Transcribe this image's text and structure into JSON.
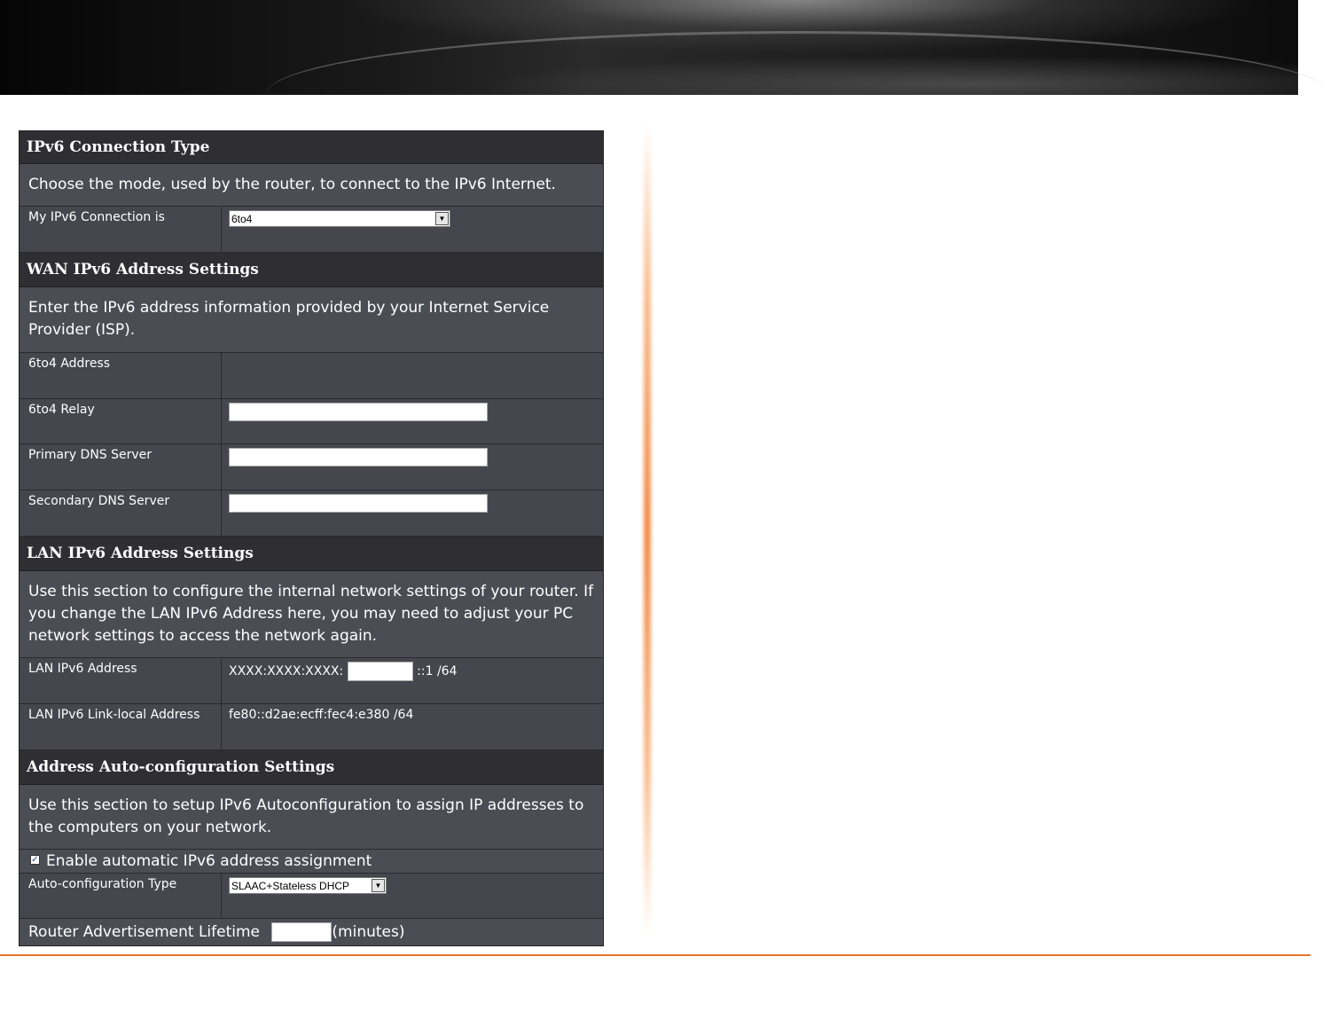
{
  "sections": {
    "connection_type": {
      "title": "IPv6 Connection Type",
      "description": "Choose the mode, used by the router, to connect to the IPv6 Internet.",
      "my_connection_label": "My IPv6 Connection is",
      "my_connection_value": "6to4"
    },
    "wan": {
      "title": "WAN IPv6 Address Settings",
      "description": "Enter the IPv6 address information provided by your Internet Service Provider (ISP).",
      "address_label": "6to4 Address",
      "address_value": "",
      "relay_label": "6to4 Relay",
      "relay_value": "",
      "primary_dns_label": "Primary DNS Server",
      "primary_dns_value": "",
      "secondary_dns_label": "Secondary DNS Server",
      "secondary_dns_value": ""
    },
    "lan": {
      "title": "LAN IPv6 Address Settings",
      "description": "Use this section to configure the internal network settings of your router. If you change the LAN IPv6 Address here, you may need to adjust your PC network settings to access the network again.",
      "address_label": "LAN IPv6 Address",
      "address_prefix": "XXXX:XXXX:XXXX:",
      "address_input_value": "",
      "address_suffix": "::1 /64",
      "link_local_label": "LAN IPv6 Link-local Address",
      "link_local_value": "fe80::d2ae:ecff:fec4:e380 /64"
    },
    "autoconfig": {
      "title": "Address Auto-configuration Settings",
      "description": "Use this section to setup IPv6 Autoconfiguration to assign IP addresses to the computers on your network.",
      "enable_label": "Enable automatic IPv6 address assignment",
      "enable_checked": true,
      "type_label": "Auto-configuration Type",
      "type_value": "SLAAC+Stateless DHCP",
      "lifetime_label": "Router Advertisement Lifetime",
      "lifetime_value": "",
      "lifetime_unit": "(minutes)"
    }
  },
  "icons": {
    "dropdown_arrow": "chevron-down-icon",
    "checkbox": "checkbox-checked-icon"
  },
  "colors": {
    "accent_rule": "#e8742a",
    "section_header_bg": "#2f2f33",
    "panel_bg": "#4b4b53"
  }
}
